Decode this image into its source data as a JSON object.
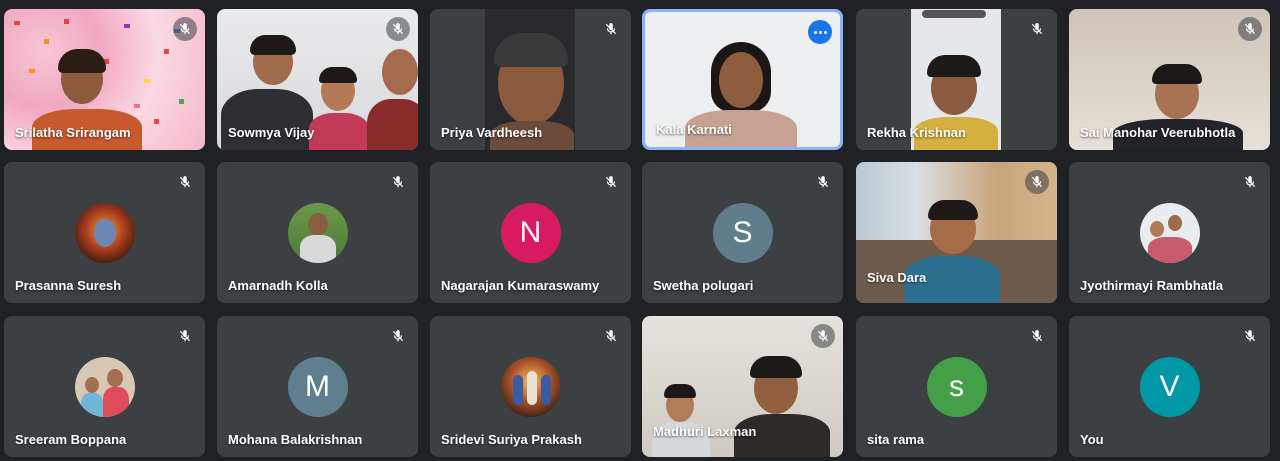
{
  "participants": [
    {
      "name": "Srilatha Srirangam"
    },
    {
      "name": "Sowmya Vijay"
    },
    {
      "name": "Priya Vardheesh"
    },
    {
      "name": "Kala Karnati"
    },
    {
      "name": "Rekha Krishnan"
    },
    {
      "name": "Sai Manohar Veerubhotla"
    },
    {
      "name": "Prasanna Suresh"
    },
    {
      "name": "Amarnadh Kolla"
    },
    {
      "name": "Nagarajan Kumaraswamy",
      "initial": "N",
      "color": "#d81b60"
    },
    {
      "name": "Swetha polugari",
      "initial": "S",
      "color": "#607d8b"
    },
    {
      "name": "Siva Dara"
    },
    {
      "name": "Jyothirmayi Rambhatla"
    },
    {
      "name": "Sreeram Boppana"
    },
    {
      "name": "Mohana Balakrishnan",
      "initial": "M",
      "color": "#5f7f8f"
    },
    {
      "name": "Sridevi Suriya Prakash"
    },
    {
      "name": "Madhuri Laxman"
    },
    {
      "name": "sita rama",
      "initial": "s",
      "color": "#43a047"
    },
    {
      "name": "You",
      "initial": "V",
      "color": "#0097a7"
    }
  ]
}
